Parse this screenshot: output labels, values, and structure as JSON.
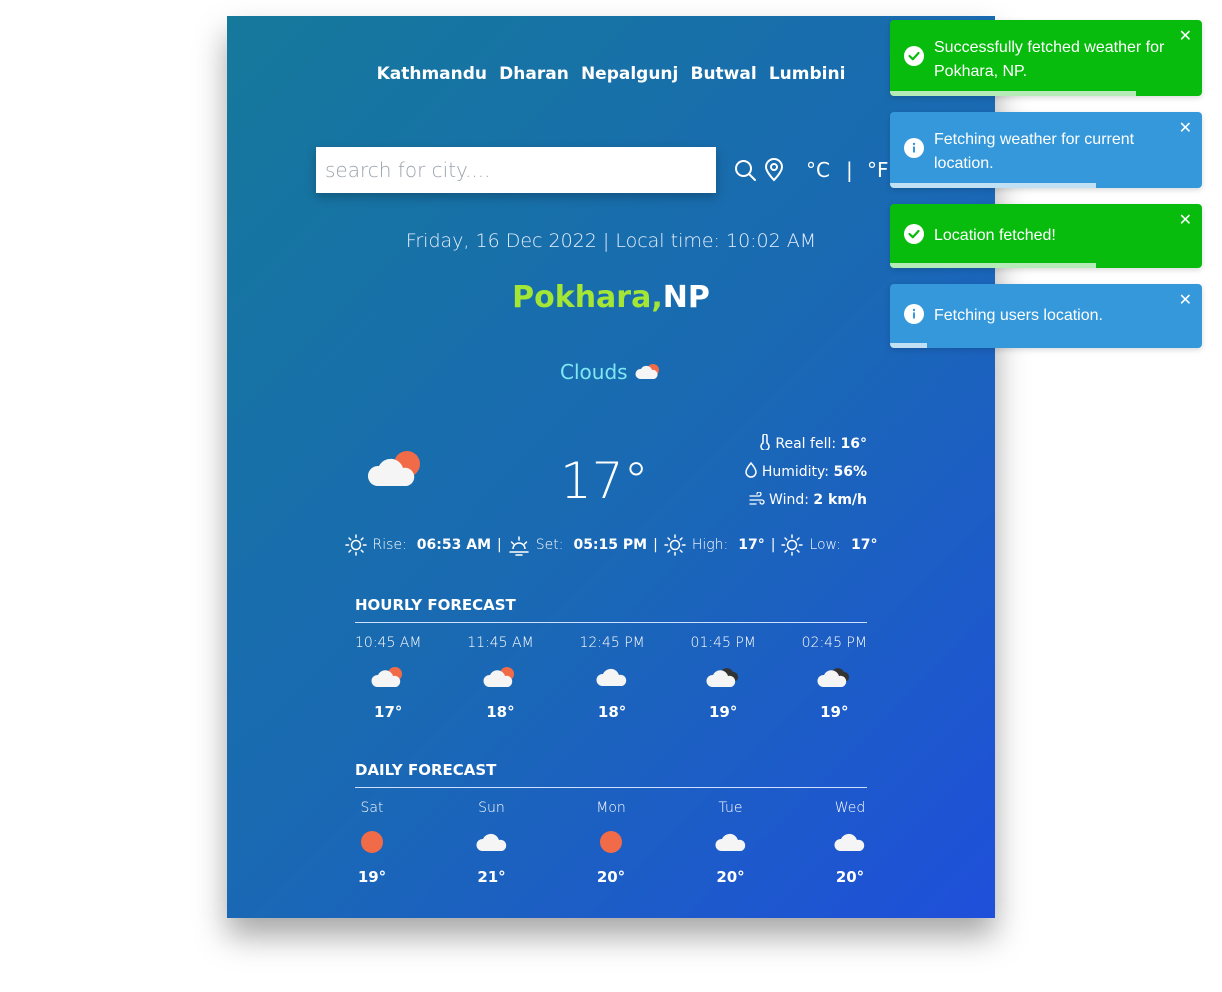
{
  "cities": [
    "Kathmandu",
    "Dharan",
    "Nepalgunj",
    "Butwal",
    "Lumbini"
  ],
  "search": {
    "placeholder": "search for city...."
  },
  "units": {
    "celsius": "°C",
    "separator": "|",
    "fahrenheit": "°F"
  },
  "datetime": "Friday, 16 Dec 2022 | Local time: 10:02 AM",
  "location": {
    "city": "Pokhara,",
    "country": "NP"
  },
  "condition": "Clouds",
  "current": {
    "temperature": "17°",
    "real_feel_label": "Real fell:",
    "real_feel": "16°",
    "humidity_label": "Humidity:",
    "humidity": "56%",
    "wind_label": "Wind:",
    "wind": "2 km/h"
  },
  "sun": {
    "rise_label": "Rise:",
    "rise": "06:53 AM",
    "set_label": "Set:",
    "set": "05:15 PM",
    "high_label": "High:",
    "high": "17°",
    "low_label": "Low:",
    "low": "17°",
    "sep": "|"
  },
  "hourly": {
    "title": "HOURLY FORECAST",
    "items": [
      {
        "time": "10:45 AM",
        "temp": "17°",
        "icon": "cloud-sun-icon"
      },
      {
        "time": "11:45 AM",
        "temp": "18°",
        "icon": "cloud-sun-icon"
      },
      {
        "time": "12:45 PM",
        "temp": "18°",
        "icon": "cloud-icon"
      },
      {
        "time": "01:45 PM",
        "temp": "19°",
        "icon": "cloud-dark-icon"
      },
      {
        "time": "02:45 PM",
        "temp": "19°",
        "icon": "cloud-dark-icon"
      }
    ]
  },
  "daily": {
    "title": "DAILY FORECAST",
    "items": [
      {
        "day": "Sat",
        "temp": "19°",
        "icon": "sun-icon"
      },
      {
        "day": "Sun",
        "temp": "21°",
        "icon": "cloud-icon"
      },
      {
        "day": "Mon",
        "temp": "20°",
        "icon": "sun-icon"
      },
      {
        "day": "Tue",
        "temp": "20°",
        "icon": "cloud-icon"
      },
      {
        "day": "Wed",
        "temp": "20°",
        "icon": "cloud-icon"
      }
    ]
  },
  "toasts": [
    {
      "type": "success",
      "message": "Successfully fetched weather for Pokhara, NP.",
      "progress": 0.79
    },
    {
      "type": "info",
      "message": "Fetching weather for current location.",
      "progress": 0.66
    },
    {
      "type": "success",
      "message": "Location fetched!",
      "progress": 0.66
    },
    {
      "type": "info",
      "message": "Fetching users location.",
      "progress": 0.12
    }
  ],
  "colors": {
    "city_accent": "#a3e635",
    "condition": "#7ee8f5",
    "toast_success": "#07bc0c",
    "toast_info": "#3498db"
  }
}
